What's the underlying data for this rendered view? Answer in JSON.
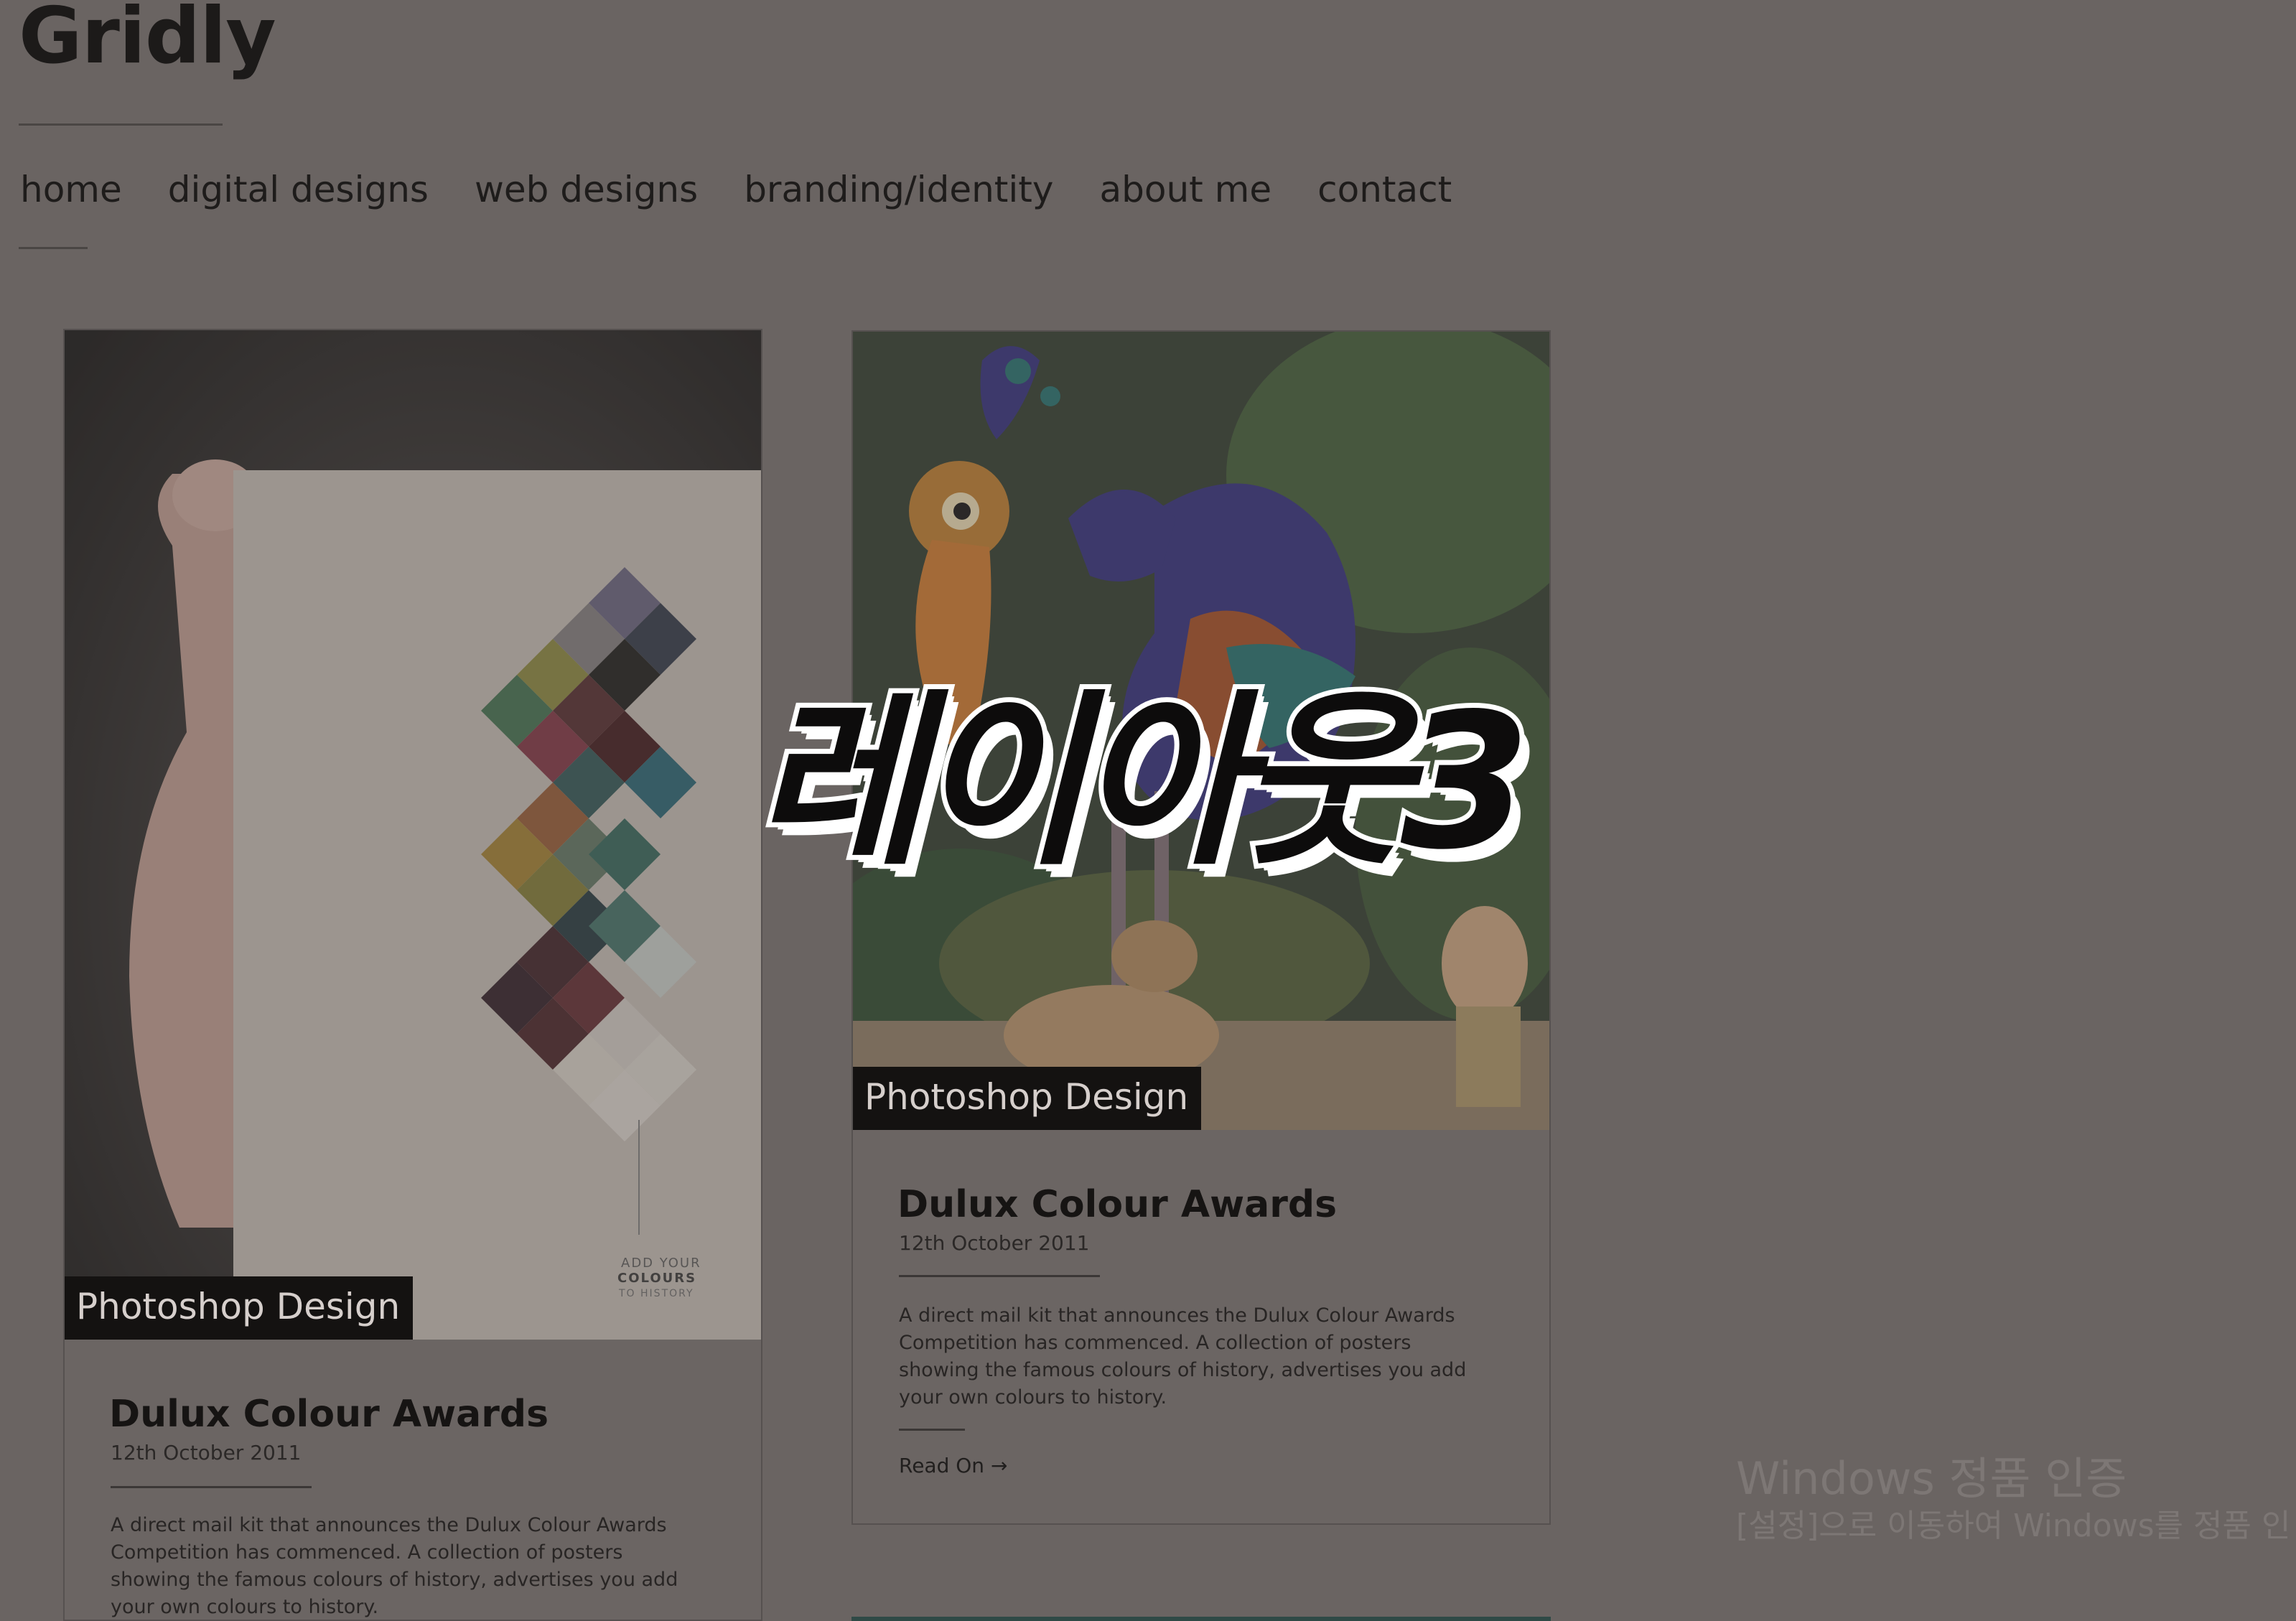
{
  "site": {
    "title": "Gridly"
  },
  "nav": {
    "items": [
      "home",
      "digital designs",
      "web designs",
      "branding/identity",
      "about me",
      "contact"
    ]
  },
  "posts": [
    {
      "category": "Photoshop Design",
      "title": "Dulux Colour Awards",
      "date": "12th October 2011",
      "excerpt": "A direct mail kit that announces the Dulux Colour Awards Competition has commenced. A collection of posters showing the famous colours of history, advertises you add your own colours to history.",
      "image": "poster-image",
      "poster_text": "ADD YOUR COLOURS TO HISTORY"
    },
    {
      "category": "Photoshop Design",
      "title": "Dulux Colour Awards",
      "date": "12th October 2011",
      "excerpt": "A direct mail kit that announces the Dulux Colour Awards Competition has commenced. A collection of posters showing the famous colours of history, advertises you add your own colours to history.",
      "read_more": "Read On →",
      "image": "bird-jungle-image"
    }
  ],
  "overlay": {
    "title": "레이아웃3"
  },
  "watermark": {
    "line1": "Windows 정품 인증",
    "line2": "[설정]으로 이동하여 Windows를 정품 인"
  }
}
